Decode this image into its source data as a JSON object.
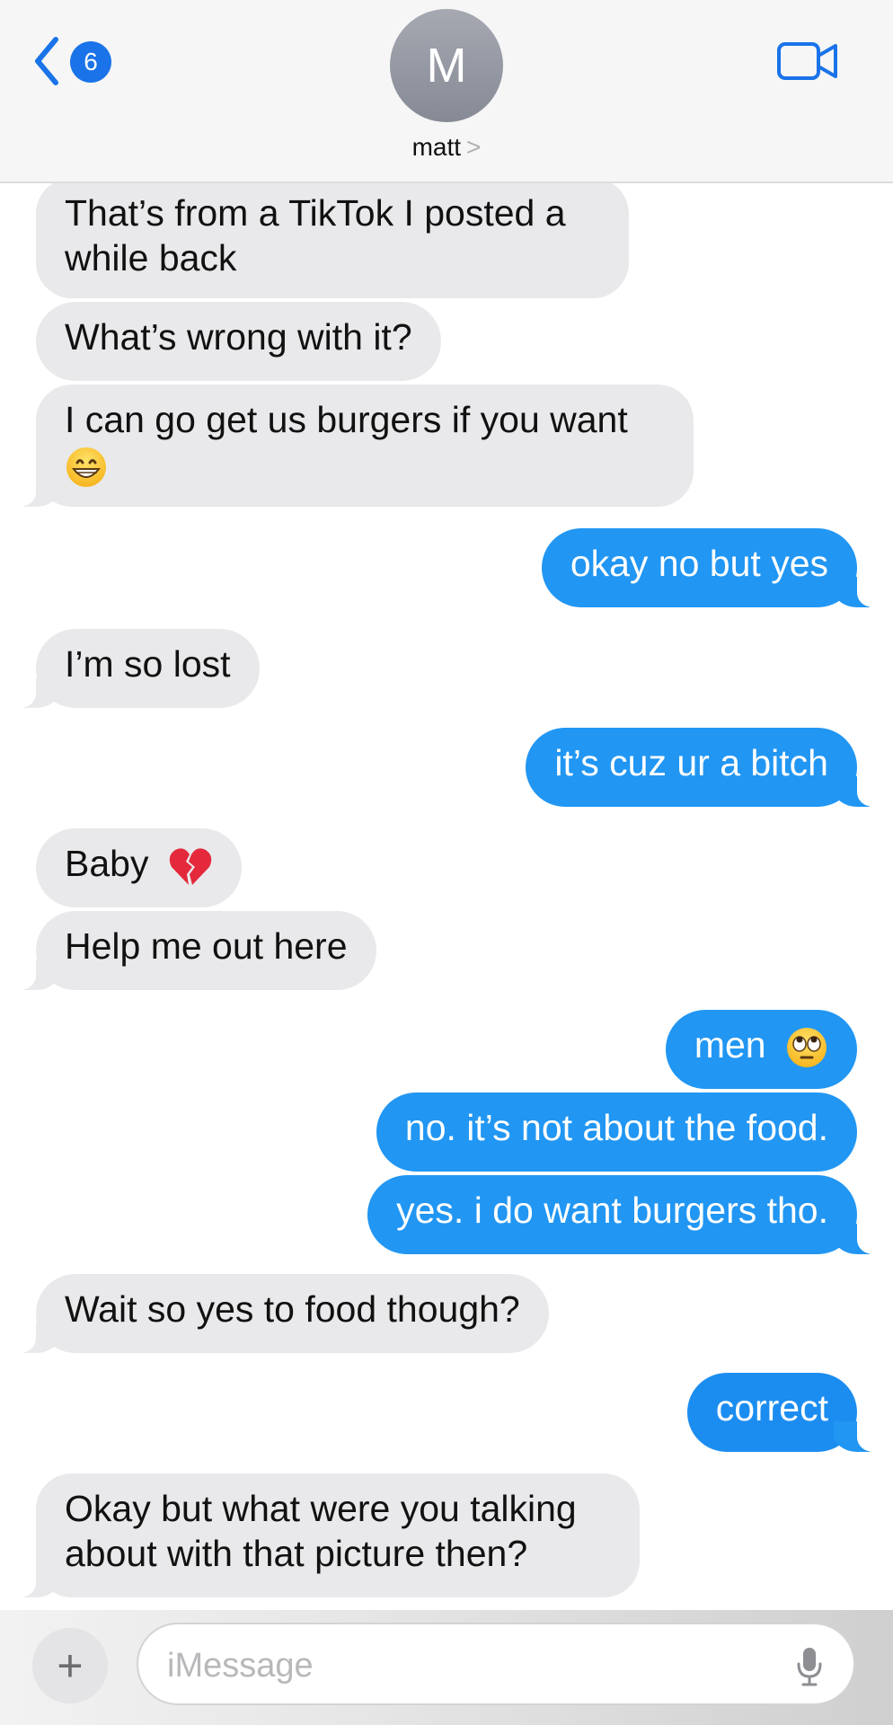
{
  "header": {
    "back_badge": "6",
    "avatar_initial": "M",
    "contact_name": "matt",
    "contact_chevron": ">"
  },
  "messages": [
    {
      "dir": "in",
      "text": "That’s from a TikTok I posted a\nwhile back"
    },
    {
      "dir": "in",
      "text": "What’s wrong with it?"
    },
    {
      "dir": "in",
      "text": "I can go get us burgers if you want",
      "emoji": "grinning-face"
    },
    {
      "dir": "out",
      "text": "okay no but yes"
    },
    {
      "dir": "in",
      "text": "I’m so lost"
    },
    {
      "dir": "out",
      "text": "it’s cuz ur a bitch"
    },
    {
      "dir": "in",
      "text": "Baby",
      "emoji": "broken-heart"
    },
    {
      "dir": "in",
      "text": "Help me out here"
    },
    {
      "dir": "out",
      "text": "men",
      "emoji": "rolling-eyes-face"
    },
    {
      "dir": "out",
      "text": "no. it’s not about the food."
    },
    {
      "dir": "out",
      "text": "yes. i do want burgers tho."
    },
    {
      "dir": "in",
      "text": "Wait so yes to food though?"
    },
    {
      "dir": "out",
      "text": "correct"
    },
    {
      "dir": "in",
      "text": "Okay but what were you talking\nabout with that picture then?"
    }
  ],
  "composer": {
    "plus_label": "+",
    "placeholder": "iMessage"
  },
  "colors": {
    "outgoing_bubble": "#2196f3",
    "incoming_bubble": "#e9e9eb",
    "accent": "#1a73e8"
  }
}
